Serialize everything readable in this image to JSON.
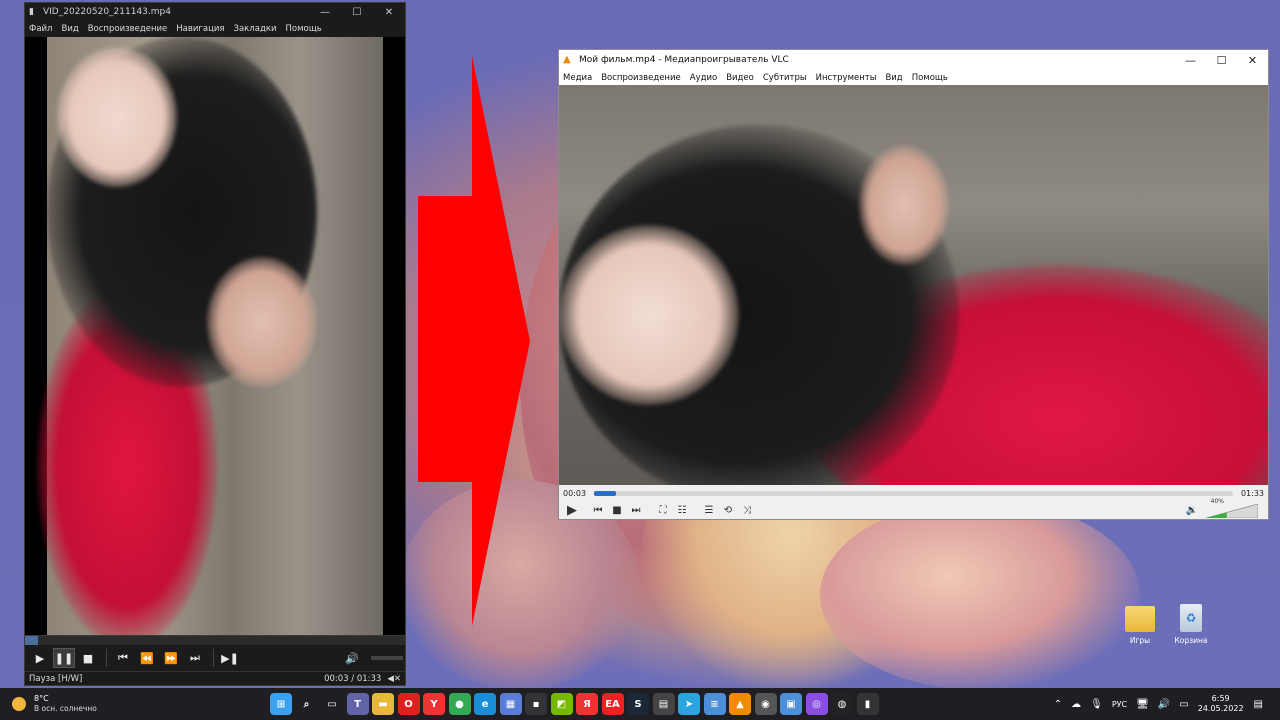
{
  "mpc": {
    "title": "VID_20220520_211143.mp4",
    "menu": [
      "Файл",
      "Вид",
      "Воспроизведение",
      "Навигация",
      "Закладки",
      "Помощь"
    ],
    "status_text": "Пауза [H/W]",
    "time": "00:03 / 01:33",
    "progress": 0.035
  },
  "vlc": {
    "title": "Мой фильм.mp4 - Медиапроигрыватель VLC",
    "menu": [
      "Медиа",
      "Воспроизведение",
      "Аудио",
      "Видео",
      "Субтитры",
      "Инструменты",
      "Вид",
      "Помощь"
    ],
    "elapsed": "00:03",
    "duration": "01:33",
    "progress": 0.035,
    "volume_label": "40%",
    "volume": 0.4
  },
  "desktop": {
    "icons": [
      {
        "label": "Игры",
        "icon": "folder-icon"
      },
      {
        "label": "Корзина",
        "icon": "recycle-bin-icon"
      }
    ]
  },
  "taskbar": {
    "weather_temp": "8°C",
    "weather_desc": "В осн. солнечно",
    "time": "6:59",
    "date": "24.05.2022",
    "lang": "РУС",
    "apps": [
      {
        "name": "start",
        "glyph": "⊞",
        "color": "#3aa0f0"
      },
      {
        "name": "search",
        "glyph": "⌕",
        "color": "#1f1f23"
      },
      {
        "name": "task-view",
        "glyph": "▭",
        "color": "#1f1f23"
      },
      {
        "name": "teams",
        "glyph": "T",
        "color": "#6264a7"
      },
      {
        "name": "explorer",
        "glyph": "▬",
        "color": "#e8b83a"
      },
      {
        "name": "opera",
        "glyph": "O",
        "color": "#e0201f"
      },
      {
        "name": "yandex-browser",
        "glyph": "Y",
        "color": "#e33"
      },
      {
        "name": "chrome",
        "glyph": "●",
        "color": "#34a853"
      },
      {
        "name": "edge",
        "glyph": "e",
        "color": "#1a8fd8"
      },
      {
        "name": "photos",
        "glyph": "▦",
        "color": "#5a7dd6"
      },
      {
        "name": "terminal",
        "glyph": "▪",
        "color": "#333"
      },
      {
        "name": "nvidia",
        "glyph": "◩",
        "color": "#76b900"
      },
      {
        "name": "yandex",
        "glyph": "Я",
        "color": "#e33"
      },
      {
        "name": "ea",
        "glyph": "EA",
        "color": "#e22"
      },
      {
        "name": "steam",
        "glyph": "S",
        "color": "#1b2838"
      },
      {
        "name": "calculator",
        "glyph": "▤",
        "color": "#444"
      },
      {
        "name": "telegram",
        "glyph": "➤",
        "color": "#2aa3df"
      },
      {
        "name": "notepad",
        "glyph": "≡",
        "color": "#4a8fd8"
      },
      {
        "name": "vlc",
        "glyph": "▲",
        "color": "#f28a00"
      },
      {
        "name": "camera",
        "glyph": "◉",
        "color": "#555"
      },
      {
        "name": "remote",
        "glyph": "▣",
        "color": "#4d8fd8"
      },
      {
        "name": "alice",
        "glyph": "◎",
        "color": "#8a4fe0"
      },
      {
        "name": "obs",
        "glyph": "◍",
        "color": "#222"
      },
      {
        "name": "mpc",
        "glyph": "▮",
        "color": "#333"
      }
    ]
  }
}
